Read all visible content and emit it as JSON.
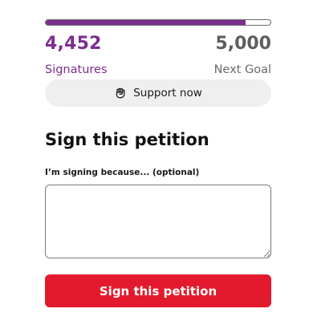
{
  "progress": {
    "fraction": 0.89,
    "fill_color": "#7d2e8e"
  },
  "signatures": {
    "count": "4,452",
    "label": "Signatures"
  },
  "goal": {
    "count": "5,000",
    "label": "Next Goal"
  },
  "support_button": {
    "label": "Support now",
    "icon": "raised-fist-icon"
  },
  "sign_section": {
    "title": "Sign this petition",
    "reason_label": "I’m signing because... (optional)",
    "reason_value": "",
    "reason_placeholder": ""
  },
  "submit_button": {
    "label": "Sign this petition",
    "color": "#e31a2d"
  }
}
